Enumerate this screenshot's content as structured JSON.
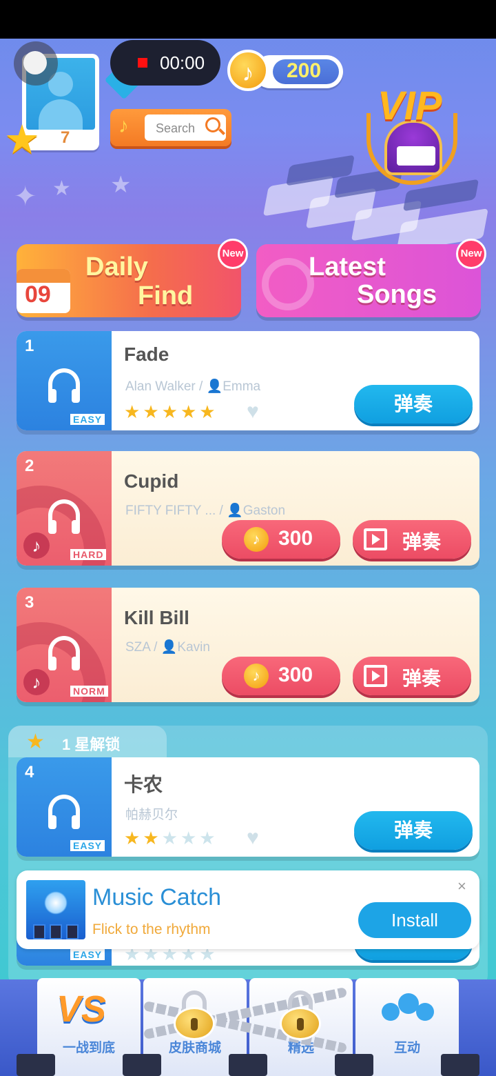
{
  "status": {
    "record_time": "00:00"
  },
  "profile": {
    "level": "7"
  },
  "coins": {
    "amount": "200"
  },
  "search": {
    "label": "Search"
  },
  "vip": {
    "label": "VIP"
  },
  "banners": [
    {
      "line1": "Daily",
      "line2": "Find",
      "calendar_day": "09",
      "badge": "New"
    },
    {
      "line1": "Latest",
      "line2": "Songs",
      "badge": "New"
    }
  ],
  "songs": [
    {
      "index": "1",
      "title": "Fade",
      "artist": "Alan Walker / ",
      "arranger": "Emma",
      "difficulty": "EASY",
      "stars": 5,
      "play_label": "弹奏"
    },
    {
      "index": "2",
      "title": "Cupid",
      "artist": "FIFTY FIFTY ... / ",
      "arranger": "Gaston",
      "difficulty": "HARD",
      "price": "300",
      "play_label": "弹奏"
    },
    {
      "index": "3",
      "title": "Kill Bill",
      "artist": "SZA / ",
      "arranger": "Kavin",
      "difficulty": "NORM",
      "price": "300",
      "play_label": "弹奏"
    },
    {
      "index": "4",
      "title": "卡农",
      "artist": "帕赫贝尔",
      "difficulty": "EASY",
      "stars": 2,
      "play_label": "弹奏"
    }
  ],
  "hidden_row": {
    "difficulty": "EASY"
  },
  "section": {
    "label": "1 星解锁"
  },
  "ad": {
    "name": "Music Catch",
    "tagline": "Flick to the rhythm",
    "install": "Install",
    "close": "×"
  },
  "nav": [
    {
      "label": "一战到底"
    },
    {
      "label": "皮肤商城"
    },
    {
      "label": "精选"
    },
    {
      "label": "互动"
    }
  ],
  "colors": {
    "accent_blue": "#109fe0",
    "accent_red": "#ec4c64",
    "star_gold": "#f7b71f"
  }
}
